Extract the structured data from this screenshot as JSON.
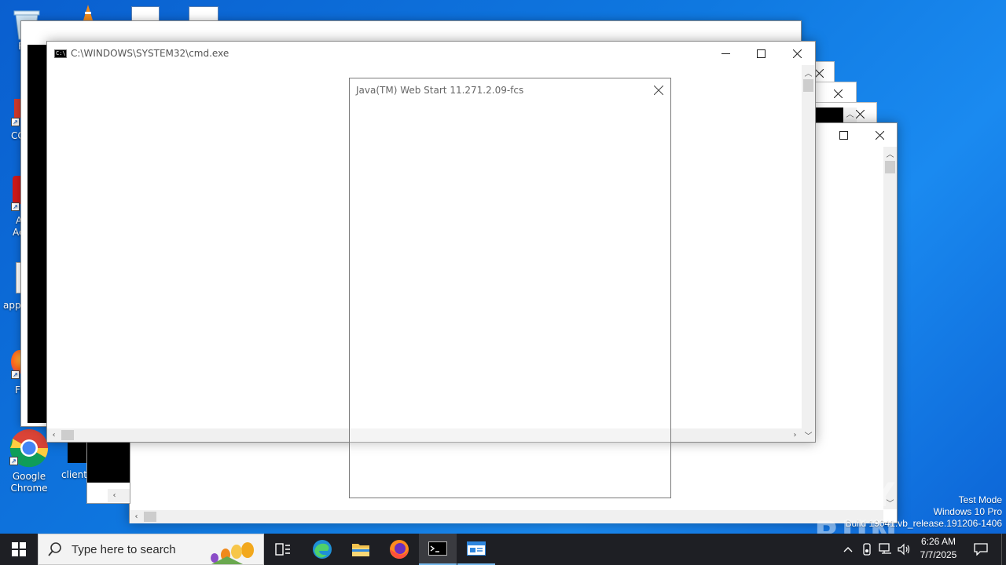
{
  "desktop": {
    "icons": [
      {
        "label": "Rec"
      },
      {
        "label": "CC"
      },
      {
        "label": "A"
      },
      {
        "label": "Ac"
      },
      {
        "label": "app"
      },
      {
        "label": "Fi"
      },
      {
        "label": "Google\nChrome"
      },
      {
        "label": "clients"
      }
    ]
  },
  "cmd_window": {
    "title": "C:\\WINDOWS\\SYSTEM32\\cmd.exe",
    "minimize_icon": "minimize-icon",
    "maximize_icon": "maximize-icon",
    "close_icon": "close-icon"
  },
  "java_dialog": {
    "title": "Java(TM) Web Start 11.271.2.09-fcs",
    "close_icon": "close-icon"
  },
  "taskbar": {
    "search_placeholder": "Type here to search",
    "apps": [
      "task-view",
      "edge",
      "file-explorer",
      "firefox",
      "cmd",
      "java-web-start"
    ],
    "clock_time": "6:26 AM",
    "clock_date": "7/7/2025"
  },
  "watermark": {
    "brand": "ANY RUN",
    "line1": "Test Mode",
    "line2": "Windows 10 Pro",
    "line3": "Build 19041.vb_release.191206-1406"
  },
  "colors": {
    "desktop_blue": "#0f78e0",
    "taskbar": "#1e1f24",
    "window_bg": "#ffffff",
    "console_black": "#000000"
  }
}
